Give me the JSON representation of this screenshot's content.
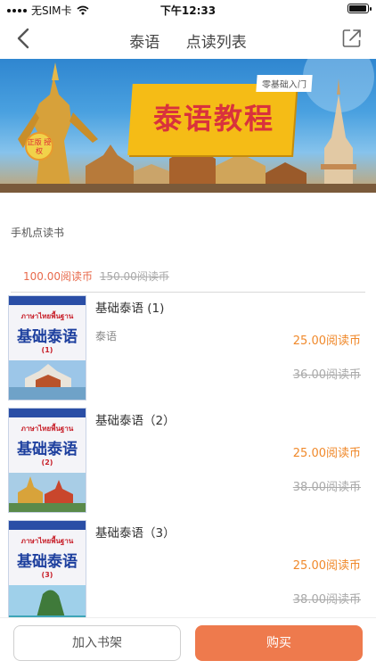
{
  "status": {
    "carrier": "无SIM卡",
    "time": "下午12:33",
    "battery_level": 0.95
  },
  "nav": {
    "title_language": "泰语",
    "title_page": "点读列表",
    "back_icon": "chevron-left-icon",
    "share_icon": "share-icon"
  },
  "banner": {
    "title": "泰语教程",
    "subtitle": "零基础入门",
    "badge": "正版 授权"
  },
  "section": {
    "label": "手机点读书",
    "price": "100.00阅读币",
    "price_old": "150.00阅读币"
  },
  "books": [
    {
      "title": "基础泰语 (1)",
      "tag": "泰语",
      "price": "25.00阅读币",
      "price_old": "36.00阅读币",
      "cover_thai": "ภาษาไทยพื้นฐาน",
      "cover_cn": "基础泰语",
      "cover_vol": "(1)"
    },
    {
      "title": "基础泰语（2）",
      "tag": "",
      "price": "25.00阅读币",
      "price_old": "38.00阅读币",
      "cover_thai": "ภาษาไทยพื้นฐาน",
      "cover_cn": "基础泰语",
      "cover_vol": "(2)"
    },
    {
      "title": "基础泰语（3）",
      "tag": "",
      "price": "25.00阅读币",
      "price_old": "38.00阅读币",
      "cover_thai": "ภาษาไทยพื้นฐาน",
      "cover_cn": "基础泰语",
      "cover_vol": "(3)"
    }
  ],
  "actions": {
    "add_to_shelf": "加入书架",
    "buy": "购买"
  },
  "colors": {
    "accent": "#ee7a4d",
    "price": "#f0892b",
    "section_price": "#e86a4c"
  }
}
